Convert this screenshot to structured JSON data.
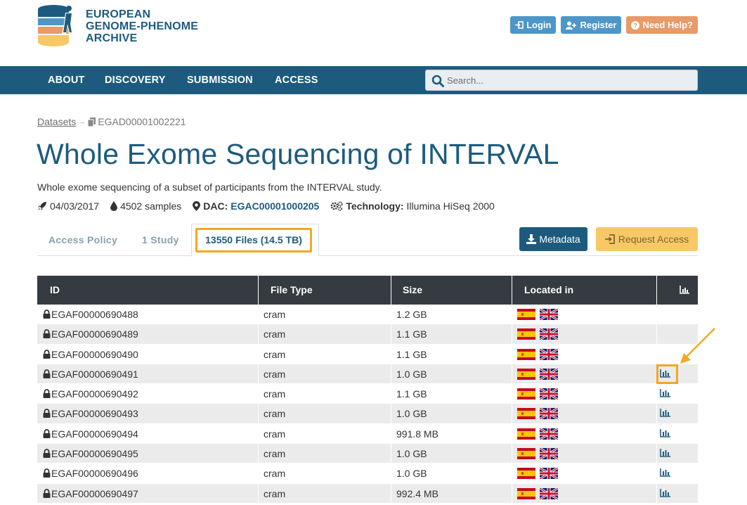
{
  "brand": {
    "line1": "EUROPEAN",
    "line2": "GENOME-PHENOME",
    "line3": "ARCHIVE"
  },
  "top_buttons": {
    "login": "Login",
    "register": "Register",
    "help": "Need Help?"
  },
  "nav": {
    "items": [
      "ABOUT",
      "DISCOVERY",
      "SUBMISSION",
      "ACCESS"
    ],
    "search_placeholder": "Search..."
  },
  "breadcrumb": {
    "parent": "Datasets",
    "current": "EGAD00001002221"
  },
  "dataset": {
    "title": "Whole Exome Sequencing of INTERVAL",
    "description": "Whole exome sequencing of a subset of participants from the INTERVAL study.",
    "date": "04/03/2017",
    "samples": "4502 samples",
    "dac_label": "DAC:",
    "dac_id": "EGAC00001000205",
    "tech_label": "Technology:",
    "technology": "Illumina HiSeq 2000"
  },
  "tabs": {
    "access_policy": "Access Policy",
    "study": "1 Study",
    "files": "13550 Files (14.5 TB)"
  },
  "actions": {
    "metadata": "Metadata",
    "request_access": "Request Access"
  },
  "table": {
    "headers": [
      "ID",
      "File Type",
      "Size",
      "Located in"
    ],
    "rows": [
      {
        "id": "EGAF00000690488",
        "type": "cram",
        "size": "1.2 GB",
        "chart": false
      },
      {
        "id": "EGAF00000690489",
        "type": "cram",
        "size": "1.1 GB",
        "chart": false
      },
      {
        "id": "EGAF00000690490",
        "type": "cram",
        "size": "1.1 GB",
        "chart": false
      },
      {
        "id": "EGAF00000690491",
        "type": "cram",
        "size": "1.0 GB",
        "chart": true
      },
      {
        "id": "EGAF00000690492",
        "type": "cram",
        "size": "1.1 GB",
        "chart": true
      },
      {
        "id": "EGAF00000690493",
        "type": "cram",
        "size": "1.0 GB",
        "chart": true
      },
      {
        "id": "EGAF00000690494",
        "type": "cram",
        "size": "991.8 MB",
        "chart": true
      },
      {
        "id": "EGAF00000690495",
        "type": "cram",
        "size": "1.0 GB",
        "chart": true
      },
      {
        "id": "EGAF00000690496",
        "type": "cram",
        "size": "1.0 GB",
        "chart": true
      },
      {
        "id": "EGAF00000690497",
        "type": "cram",
        "size": "992.4 MB",
        "chart": true
      }
    ]
  },
  "colors": {
    "brand_blue": "#1d5b7e",
    "highlight": "#f2a725",
    "help_orange": "#e89a68",
    "request_yellow": "#f7c865"
  },
  "icons": [
    "login-icon",
    "register-icon",
    "help-icon",
    "search-icon",
    "copy-icon",
    "rocket-icon",
    "drop-icon",
    "map-marker-icon",
    "cogs-icon",
    "download-icon",
    "sign-in-icon",
    "lock-icon",
    "spain-flag-icon",
    "uk-flag-icon",
    "bar-chart-icon",
    "arrow-icon"
  ]
}
